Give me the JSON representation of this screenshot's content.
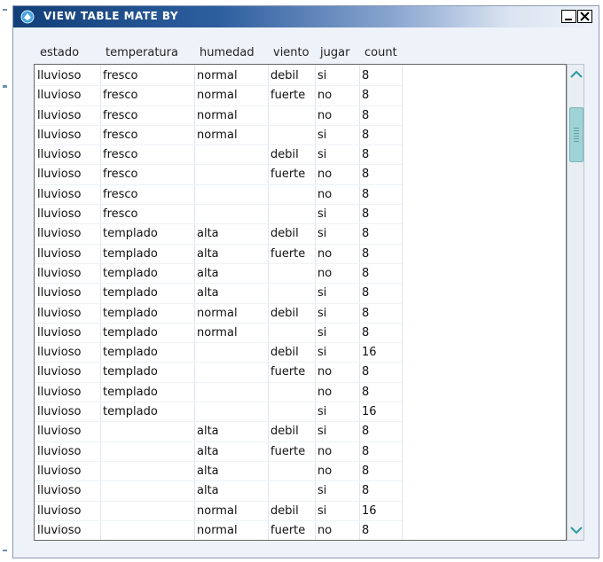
{
  "window": {
    "title": "VIEW TABLE MATE BY"
  },
  "table": {
    "columns": [
      "estado",
      "temperatura",
      "humedad",
      "viento",
      "jugar",
      "count"
    ],
    "rows": [
      [
        "lluvioso",
        "fresco",
        "normal",
        "debil",
        "si",
        "8"
      ],
      [
        "lluvioso",
        "fresco",
        "normal",
        "fuerte",
        "no",
        "8"
      ],
      [
        "lluvioso",
        "fresco",
        "normal",
        "",
        "no",
        "8"
      ],
      [
        "lluvioso",
        "fresco",
        "normal",
        "",
        "si",
        "8"
      ],
      [
        "lluvioso",
        "fresco",
        "",
        "debil",
        "si",
        "8"
      ],
      [
        "lluvioso",
        "fresco",
        "",
        "fuerte",
        "no",
        "8"
      ],
      [
        "lluvioso",
        "fresco",
        "",
        "",
        "no",
        "8"
      ],
      [
        "lluvioso",
        "fresco",
        "",
        "",
        "si",
        "8"
      ],
      [
        "lluvioso",
        "templado",
        "alta",
        "debil",
        "si",
        "8"
      ],
      [
        "lluvioso",
        "templado",
        "alta",
        "fuerte",
        "no",
        "8"
      ],
      [
        "lluvioso",
        "templado",
        "alta",
        "",
        "no",
        "8"
      ],
      [
        "lluvioso",
        "templado",
        "alta",
        "",
        "si",
        "8"
      ],
      [
        "lluvioso",
        "templado",
        "normal",
        "debil",
        "si",
        "8"
      ],
      [
        "lluvioso",
        "templado",
        "normal",
        "",
        "si",
        "8"
      ],
      [
        "lluvioso",
        "templado",
        "",
        "debil",
        "si",
        "16"
      ],
      [
        "lluvioso",
        "templado",
        "",
        "fuerte",
        "no",
        "8"
      ],
      [
        "lluvioso",
        "templado",
        "",
        "",
        "no",
        "8"
      ],
      [
        "lluvioso",
        "templado",
        "",
        "",
        "si",
        "16"
      ],
      [
        "lluvioso",
        "",
        "alta",
        "debil",
        "si",
        "8"
      ],
      [
        "lluvioso",
        "",
        "alta",
        "fuerte",
        "no",
        "8"
      ],
      [
        "lluvioso",
        "",
        "alta",
        "",
        "no",
        "8"
      ],
      [
        "lluvioso",
        "",
        "alta",
        "",
        "si",
        "8"
      ],
      [
        "lluvioso",
        "",
        "normal",
        "debil",
        "si",
        "16"
      ],
      [
        "lluvioso",
        "",
        "normal",
        "fuerte",
        "no",
        "8"
      ]
    ]
  },
  "icons": {
    "app": "app-icon",
    "minimize": "minimize-icon",
    "close": "close-icon",
    "scroll_up": "chevron-up-icon",
    "scroll_down": "chevron-down-icon"
  },
  "colors": {
    "title_start": "#123f78",
    "window_bg": "#eef2f9",
    "scroll_thumb": "#9fd3d6"
  }
}
